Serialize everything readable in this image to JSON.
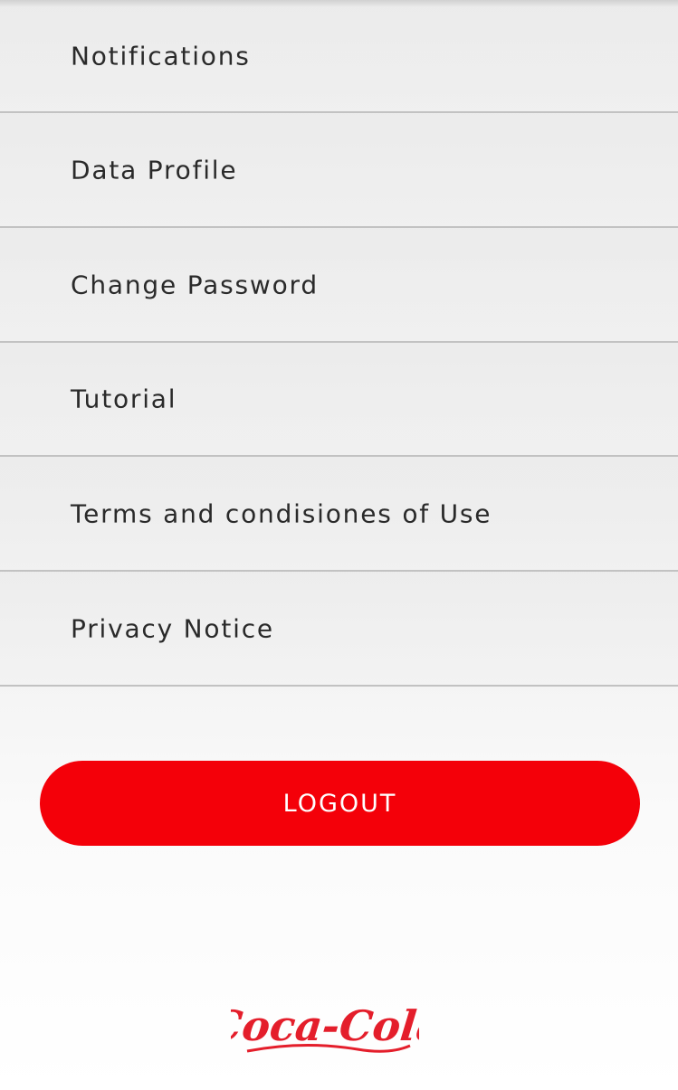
{
  "menu": {
    "items": [
      {
        "label": "Notifications"
      },
      {
        "label": "Data Profile"
      },
      {
        "label": "Change Password"
      },
      {
        "label": "Tutorial"
      },
      {
        "label": "Terms and condisiones of Use"
      },
      {
        "label": "Privacy Notice"
      }
    ]
  },
  "logout": {
    "label": "LOGOUT"
  },
  "logo": {
    "text": "Coca-Cola",
    "icon": "coca-cola-logo",
    "color": "#e41e2b"
  },
  "colors": {
    "accent": "#f40009"
  }
}
